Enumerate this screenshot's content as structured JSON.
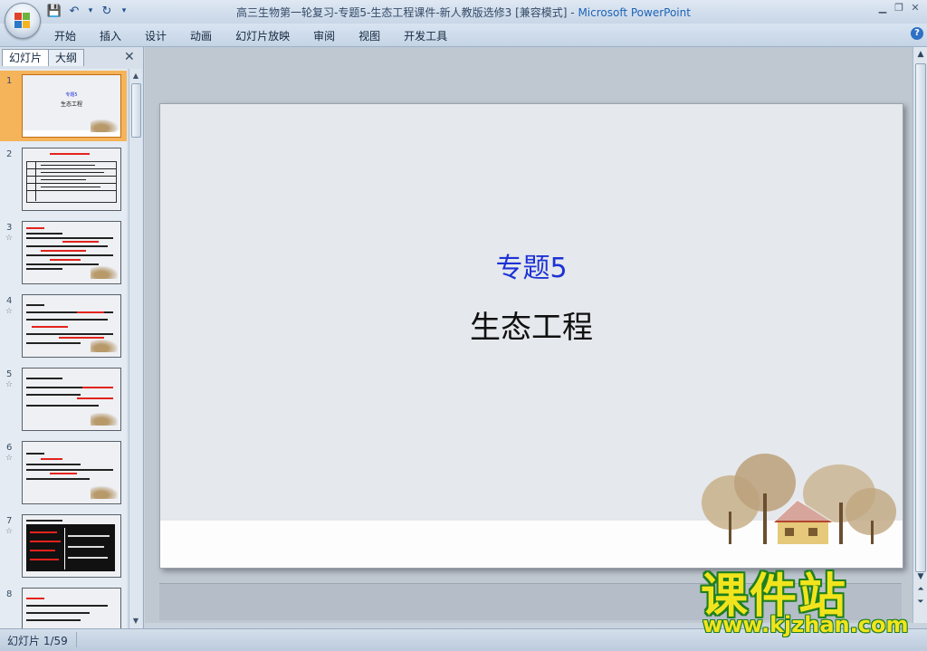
{
  "window": {
    "title": "高三生物第一轮复习-专题5-生态工程课件-新人教版选修3 [兼容模式]",
    "separator": " - ",
    "app_name": "Microsoft PowerPoint",
    "min_glyph": "▁",
    "restore_glyph": "❐",
    "close_glyph": "✕"
  },
  "quick_access": {
    "save_icon": "💾",
    "undo_icon": "↶",
    "undo_dropdown_icon": "▾",
    "redo_icon": "↻",
    "customize_icon": "▾"
  },
  "ribbon": {
    "tabs": [
      "开始",
      "插入",
      "设计",
      "动画",
      "幻灯片放映",
      "审阅",
      "视图",
      "开发工具"
    ],
    "help_glyph": "?"
  },
  "left_panel": {
    "tabs": [
      "幻灯片",
      "大纲"
    ],
    "close_glyph": "✕",
    "scroll_up": "▲",
    "scroll_down": "▼",
    "thumbnails": [
      {
        "num": "1",
        "star": "",
        "selected": true,
        "sub": "专题5",
        "title": "生态工程"
      },
      {
        "num": "2",
        "star": ""
      },
      {
        "num": "3",
        "star": "☆"
      },
      {
        "num": "4",
        "star": "☆"
      },
      {
        "num": "5",
        "star": "☆"
      },
      {
        "num": "6",
        "star": "☆"
      },
      {
        "num": "7",
        "star": "☆"
      },
      {
        "num": "8",
        "star": ""
      }
    ]
  },
  "slide": {
    "subtitle": "专题5",
    "title": "生态工程",
    "subtitle_color": "#1d32d6",
    "title_color": "#101010"
  },
  "right_scroll": {
    "up": "▲",
    "down": "▼",
    "prev": "⏶",
    "next": "⏷"
  },
  "status": {
    "slide_indicator": "幻灯片 1/59"
  },
  "watermark": {
    "text": "课件站",
    "url": "www.kjzhan.com"
  }
}
